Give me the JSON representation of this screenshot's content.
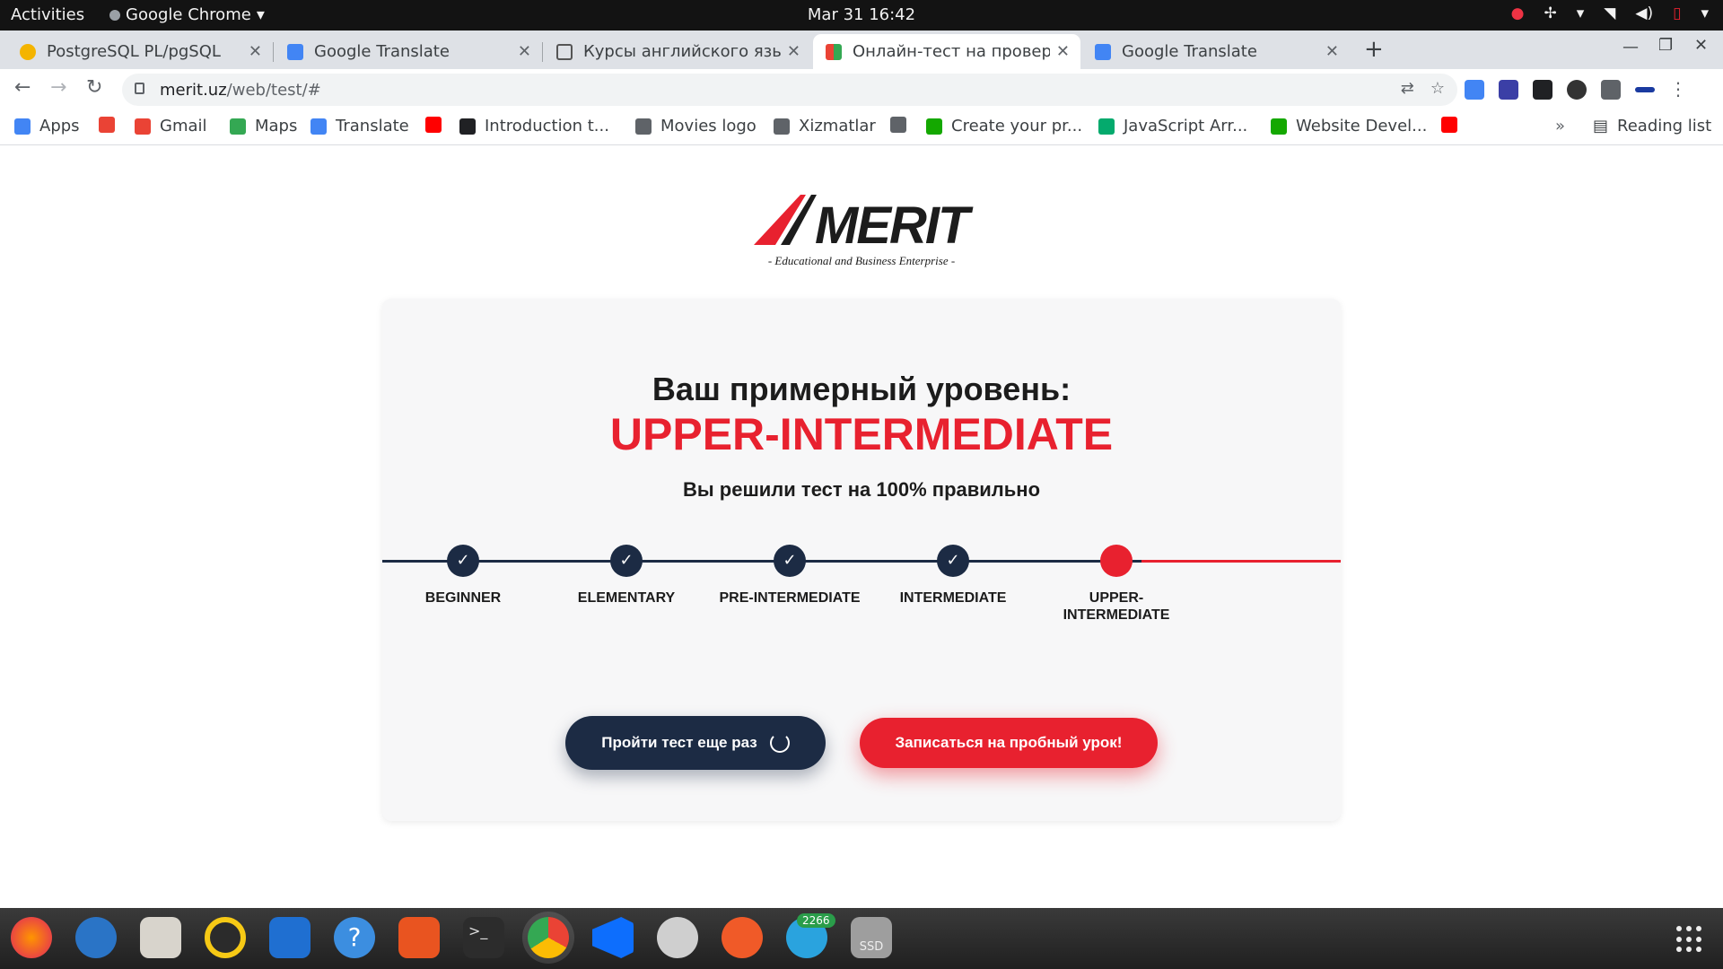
{
  "topbar": {
    "activities": "Activities",
    "app_name": "Google Chrome",
    "clock": "Mar 31  16:42"
  },
  "tabs": [
    {
      "title": "PostgreSQL PL/pgSQL",
      "favicon_color": "#f4b400"
    },
    {
      "title": "Google Translate",
      "favicon_color": "#4285f4"
    },
    {
      "title": "Курсы английского язык",
      "favicon_color": "#555555"
    },
    {
      "title": "Онлайн-тест на проверк",
      "favicon_color": "#fbbc04"
    },
    {
      "title": "Google Translate",
      "favicon_color": "#4285f4"
    }
  ],
  "omnibox": {
    "host": "merit.uz",
    "path": "/web/test/#"
  },
  "bookmarks": [
    {
      "label": "Apps",
      "icon": "apps-grid-icon",
      "color": "#4285f4"
    },
    {
      "label": "",
      "icon": "google-icon",
      "color": "#ea4335"
    },
    {
      "label": "Gmail",
      "icon": "gmail-icon",
      "color": "#ea4335"
    },
    {
      "label": "Maps",
      "icon": "maps-icon",
      "color": "#34a853"
    },
    {
      "label": "Translate",
      "icon": "translate-icon",
      "color": "#4285f4"
    },
    {
      "label": "",
      "icon": "youtube-icon",
      "color": "#ff0000"
    },
    {
      "label": "Introduction t...",
      "icon": "doc-icon",
      "color": "#202124"
    },
    {
      "label": "Movies logo",
      "icon": "globe-icon",
      "color": "#5f6368"
    },
    {
      "label": "Xizmatlar",
      "icon": "globe-icon",
      "color": "#5f6368"
    },
    {
      "label": "",
      "icon": "globe-icon",
      "color": "#5f6368"
    },
    {
      "label": "Create your pr...",
      "icon": "upwork-icon",
      "color": "#14a800"
    },
    {
      "label": "JavaScript Arr...",
      "icon": "w3-icon",
      "color": "#04aa6d"
    },
    {
      "label": "Website Devel...",
      "icon": "upwork-icon",
      "color": "#14a800"
    },
    {
      "label": "",
      "icon": "youtube-icon",
      "color": "#ff0000"
    }
  ],
  "bookmarks_more": "»",
  "reading_list": "Reading list",
  "logo": {
    "brand": "MERIT",
    "tagline": "- Educational and Business Enterprise -"
  },
  "result": {
    "heading": "Ваш примерный уровень:",
    "level": "UPPER-INTERMEDIATE",
    "score_text": "Вы решили тест на 100% правильно"
  },
  "steps": [
    {
      "label": "BEGINNER",
      "status": "completed"
    },
    {
      "label": "ELEMENTARY",
      "status": "completed"
    },
    {
      "label": "PRE-INTERMEDIATE",
      "status": "completed"
    },
    {
      "label": "INTERMEDIATE",
      "status": "completed"
    },
    {
      "label": "UPPER-\nINTERMEDIATE",
      "status": "current"
    }
  ],
  "buttons": {
    "retry": "Пройти тест еще раз",
    "trial": "Записаться на пробный урок!"
  },
  "dock": {
    "telegram_badge": "2266",
    "ssd_label": "SSD"
  },
  "colors": {
    "accent_red": "#e8212f",
    "navy": "#1c2b44"
  }
}
